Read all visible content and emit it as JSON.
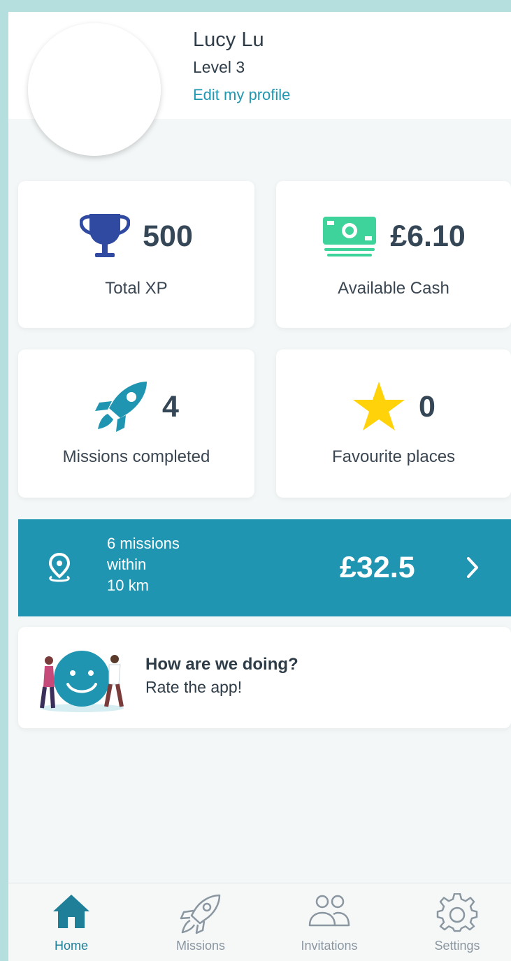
{
  "profile": {
    "name": "Lucy Lu",
    "level": "Level 3",
    "edit_link": "Edit my profile"
  },
  "stats": {
    "xp": {
      "value": "500",
      "label": "Total XP",
      "icon": "trophy-icon",
      "color": "#2f4aa0"
    },
    "cash": {
      "value": "£6.10",
      "label": "Available Cash",
      "icon": "cash-icon",
      "color": "#3ed39b"
    },
    "missions": {
      "value": "4",
      "label": "Missions completed",
      "icon": "rocket-icon",
      "color": "#1f95b1"
    },
    "favourites": {
      "value": "0",
      "label": "Favourite places",
      "icon": "star-icon",
      "color": "#ffd20a"
    }
  },
  "banner": {
    "line1": "6 missions",
    "line2": "within",
    "line3": "10 km",
    "amount": "£32.5",
    "icon": "location-pin-icon",
    "color": "#1f95b1"
  },
  "rate": {
    "title": "How are we doing?",
    "subtitle": "Rate the app!",
    "icon": "smiley-illustration"
  },
  "tabs": [
    {
      "label": "Home",
      "icon": "home-icon",
      "active": true
    },
    {
      "label": "Missions",
      "icon": "rocket-outline-icon",
      "active": false
    },
    {
      "label": "Invitations",
      "icon": "people-icon",
      "active": false
    },
    {
      "label": "Settings",
      "icon": "gear-icon",
      "active": false
    }
  ],
  "colors": {
    "accent": "#1f95b1",
    "link": "#2098b0",
    "text": "#2e3c48",
    "background": "#f3f7f7"
  }
}
